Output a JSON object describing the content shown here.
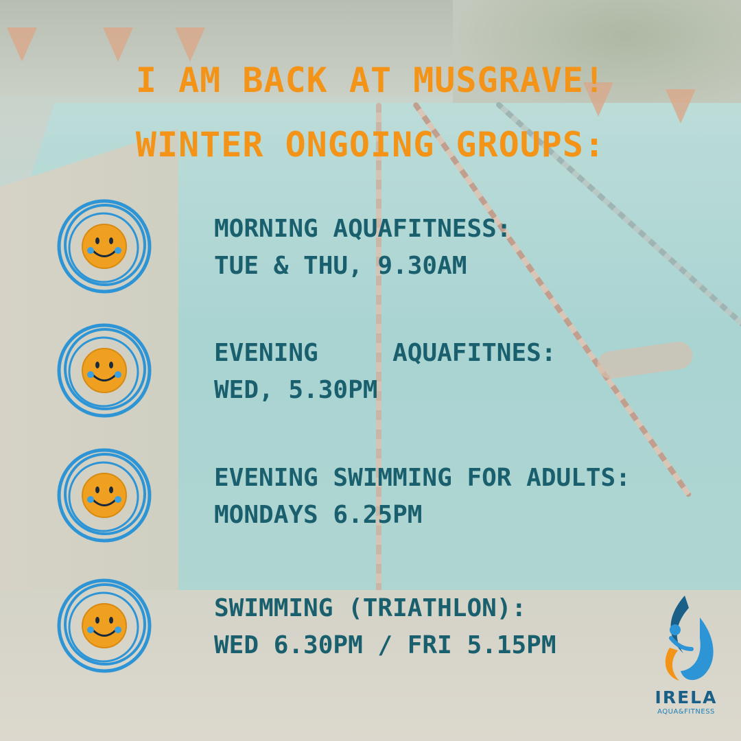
{
  "headline": {
    "line1": "I AM BACK AT MUSGRAVE!",
    "line2": "WINTER ONGOING GROUPS:"
  },
  "groups": [
    {
      "line1": "MORNING AQUAFITNESS:",
      "line2": "TUE & THU, 9.30AM"
    },
    {
      "line1": "EVENING     AQUAFITNES:",
      "line2": "WED, 5.30PM"
    },
    {
      "line1": "EVENING SWIMMING FOR ADULTS:",
      "line2": "MONDAYS 6.25PM"
    },
    {
      "line1": "SWIMMING (TRIATHLON):",
      "line2": "WED 6.30PM / FRI 5.15PM"
    }
  ],
  "logo": {
    "brand": "IRELA",
    "tagline": "AQUA&FITNESS"
  },
  "colors": {
    "headline": "#f39418",
    "group_text": "#1a5f6d",
    "ring": "#2d95d6",
    "smiley": "#f0a020"
  },
  "icons": [
    "smiley-badge-icon",
    "logo-drop-icon"
  ]
}
